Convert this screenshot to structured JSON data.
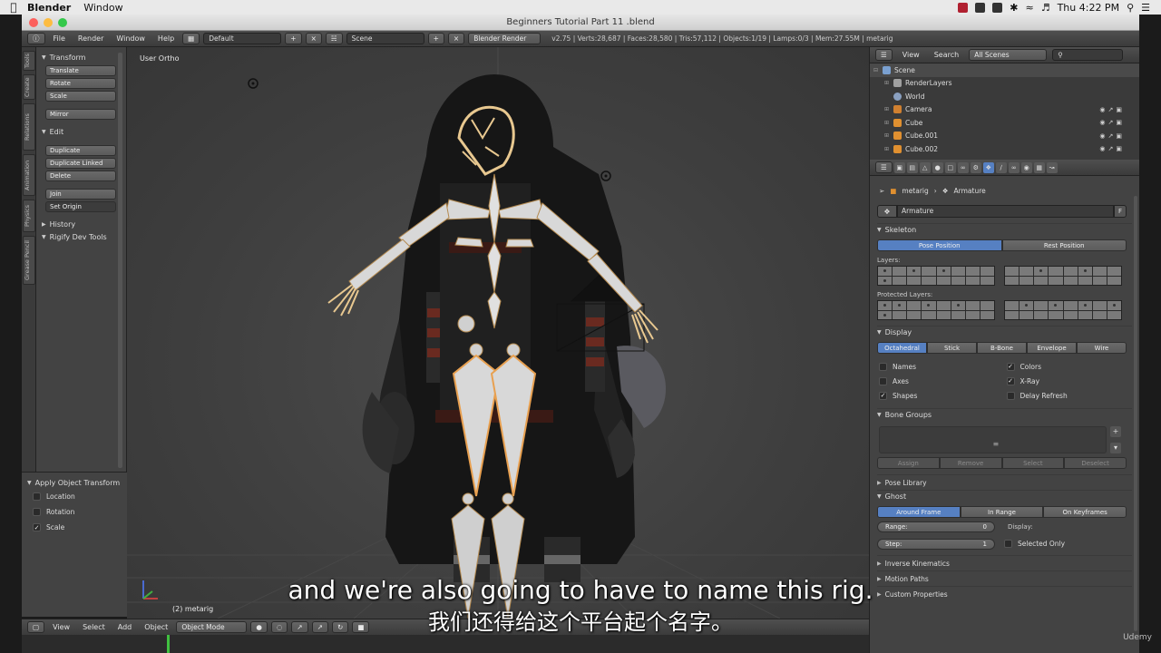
{
  "mac_menubar": {
    "app": "Blender",
    "menus": [
      "Window"
    ],
    "clock": "Thu 4:22 PM"
  },
  "window": {
    "title": "Beginners Tutorial Part 11 .blend"
  },
  "info_header": {
    "menus": [
      "File",
      "Render",
      "Window",
      "Help"
    ],
    "layout": "Default",
    "scene": "Scene",
    "engine": "Blender Render",
    "stats": "v2.75 | Verts:28,687 | Faces:28,580 | Tris:57,112 | Objects:1/19 | Lamps:0/3 | Mem:27.55M | metarig"
  },
  "tool_tabs": [
    "Tools",
    "Create",
    "Relations",
    "Animation",
    "Physics",
    "Grease Pencil"
  ],
  "tool_shelf": {
    "transform_title": "Transform",
    "transform_buttons": [
      "Translate",
      "Rotate",
      "Scale"
    ],
    "mirror": "Mirror",
    "edit_title": "Edit",
    "edit_buttons": [
      "Duplicate",
      "Duplicate Linked",
      "Delete"
    ],
    "join": "Join",
    "set_origin": "Set Origin",
    "history": "History",
    "rigify": "Rigify Dev Tools"
  },
  "apply_panel": {
    "title": "Apply Object Transform",
    "options": [
      {
        "label": "Location",
        "checked": false
      },
      {
        "label": "Rotation",
        "checked": false
      },
      {
        "label": "Scale",
        "checked": true
      }
    ]
  },
  "viewport": {
    "view_label": "User Ortho",
    "object_label": "(2) metarig"
  },
  "viewport_header": {
    "menus": [
      "View",
      "Select",
      "Add",
      "Object"
    ],
    "mode": "Object Mode"
  },
  "outliner": {
    "header": [
      "View",
      "Search"
    ],
    "filter": "All Scenes",
    "rows": [
      {
        "label": "Scene",
        "color": "#7aa0d0",
        "indent": 0
      },
      {
        "label": "RenderLayers",
        "color": "#a0a0a0",
        "indent": 1
      },
      {
        "label": "World",
        "color": "#8aa0c0",
        "indent": 1
      },
      {
        "label": "Camera",
        "color": "#d08030",
        "indent": 1
      },
      {
        "label": "Cube",
        "color": "#e09030",
        "indent": 1
      },
      {
        "label": "Cube.001",
        "color": "#e09030",
        "indent": 1
      },
      {
        "label": "Cube.002",
        "color": "#e09030",
        "indent": 1
      }
    ]
  },
  "properties": {
    "breadcrumb": [
      "metarig",
      "Armature"
    ],
    "data_name": "Armature",
    "fake_user": "F",
    "skeleton": {
      "title": "Skeleton",
      "positions": [
        "Pose Position",
        "Rest Position"
      ],
      "layers_label": "Layers:",
      "protected_label": "Protected Layers:"
    },
    "display": {
      "title": "Display",
      "modes": [
        "Octahedral",
        "Stick",
        "B-Bone",
        "Envelope",
        "Wire"
      ],
      "left_options": [
        {
          "label": "Names",
          "checked": false
        },
        {
          "label": "Axes",
          "checked": false
        },
        {
          "label": "Shapes",
          "checked": true
        }
      ],
      "right_options": [
        {
          "label": "Colors",
          "checked": true
        },
        {
          "label": "X-Ray",
          "checked": true
        },
        {
          "label": "Delay Refresh",
          "checked": false
        }
      ]
    },
    "bone_groups": {
      "title": "Bone Groups",
      "buttons": [
        "Assign",
        "Remove",
        "Select",
        "Deselect"
      ]
    },
    "pose_library": "Pose Library",
    "ghost": {
      "title": "Ghost",
      "modes": [
        "Around Frame",
        "In Range",
        "On Keyframes"
      ],
      "range_label": "Range:",
      "range_value": "0",
      "step_label": "Step:",
      "step_value": "1",
      "display_label": "Display:",
      "selected_only": "Selected Only"
    },
    "collapsed": [
      "Inverse Kinematics",
      "Motion Paths",
      "Custom Properties"
    ]
  },
  "subtitles": {
    "en": "and we're also going to have to name this rig.",
    "zh": "我们还得给这个平台起个名字。"
  },
  "watermark": "Udemy",
  "colors": {
    "accent": "#5680c2",
    "bone": "#e8b87a",
    "background": "#3e3e3e"
  }
}
